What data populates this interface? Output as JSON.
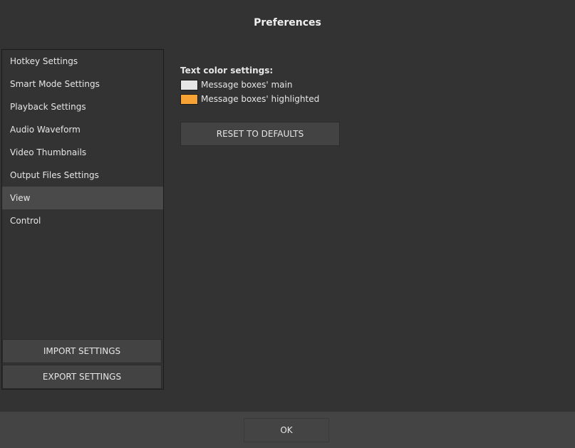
{
  "window": {
    "title": "Preferences"
  },
  "sidebar": {
    "items": [
      {
        "label": "Hotkey Settings",
        "selected": false
      },
      {
        "label": "Smart Mode Settings",
        "selected": false
      },
      {
        "label": "Playback Settings",
        "selected": false
      },
      {
        "label": "Audio Waveform",
        "selected": false
      },
      {
        "label": "Video Thumbnails",
        "selected": false
      },
      {
        "label": "Output Files Settings",
        "selected": false
      },
      {
        "label": "View",
        "selected": true
      },
      {
        "label": "Control",
        "selected": false
      }
    ],
    "import_label": "IMPORT SETTINGS",
    "export_label": "EXPORT SETTINGS"
  },
  "content": {
    "section_label": "Text color settings:",
    "colors": [
      {
        "label": "Message boxes' main",
        "color": "#e6e6e6"
      },
      {
        "label": "Message boxes' highlighted",
        "color": "#f7a234"
      }
    ],
    "reset_label": "RESET TO DEFAULTS"
  },
  "footer": {
    "ok_label": "OK"
  },
  "theme": {
    "background": "#333333",
    "selected_item": "#4a4a4a",
    "button": "#434343",
    "footer": "#444444"
  }
}
